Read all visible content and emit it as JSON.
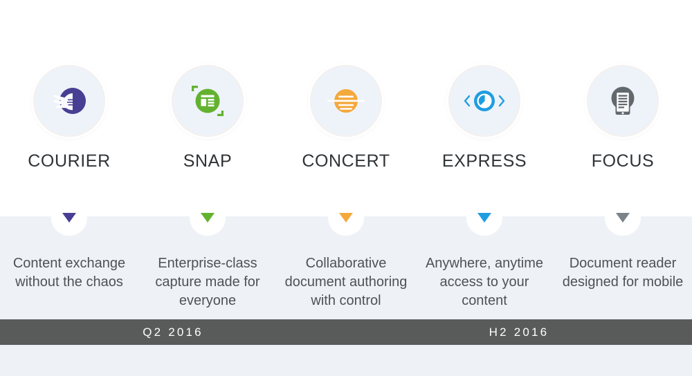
{
  "theme": {
    "page_bg": "#ffffff",
    "panel_bg": "#eef2f7",
    "timeline_bg": "#595b5b",
    "badge_bg": "#eef3f9",
    "title_color": "#2f3336",
    "desc_color": "#4c5257"
  },
  "products": [
    {
      "name": "COURIER",
      "icon": "winged-hand-icon",
      "accent": "#473f93",
      "description": "Content exchange without the chaos"
    },
    {
      "name": "SNAP",
      "icon": "capture-document-icon",
      "accent": "#63b22f",
      "description": "Enterprise-class capture made for everyone"
    },
    {
      "name": "CONCERT",
      "icon": "orange-document-disc-icon",
      "accent": "#f4a93c",
      "description": "Collaborative document authoring with control"
    },
    {
      "name": "EXPRESS",
      "icon": "blue-eye-chevrons-icon",
      "accent": "#1f9de0",
      "description": "Anywhere, anytime access to your content"
    },
    {
      "name": "FOCUS",
      "icon": "mobile-reader-icon",
      "accent": "#7b8288",
      "description": "Document reader designed for mobile"
    }
  ],
  "timeline": {
    "segments": [
      {
        "label": "Q2 2016"
      },
      {
        "label": "H2 2016"
      }
    ]
  }
}
